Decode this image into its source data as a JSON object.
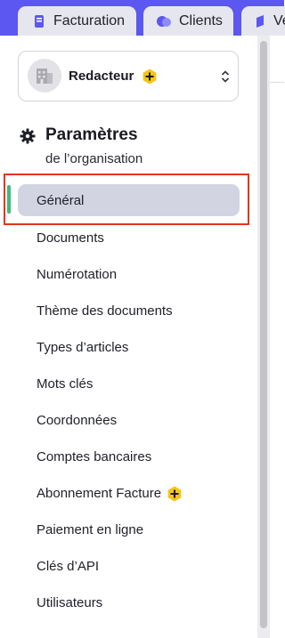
{
  "tabs": [
    {
      "label": "Facturation",
      "icon": "invoice-icon"
    },
    {
      "label": "Clients",
      "icon": "clients-icon"
    },
    {
      "label": "Ve",
      "icon": "sales-icon"
    }
  ],
  "org": {
    "name": "Redacteur",
    "premium": true
  },
  "section": {
    "title": "Paramètres",
    "subtitle": "de l’organisation"
  },
  "nav": [
    {
      "label": "Général",
      "active": true
    },
    {
      "label": "Documents"
    },
    {
      "label": "Numérotation"
    },
    {
      "label": "Thème des documents"
    },
    {
      "label": "Types d’articles"
    },
    {
      "label": "Mots clés"
    },
    {
      "label": "Coordonnées"
    },
    {
      "label": "Comptes bancaires"
    },
    {
      "label": "Abonnement Facture",
      "premium": true
    },
    {
      "label": "Paiement en ligne"
    },
    {
      "label": "Clés d’API"
    },
    {
      "label": "Utilisateurs"
    }
  ],
  "colors": {
    "accent": "#5b57f0",
    "active_marker": "#3cbc7d",
    "premium": "#f5c518",
    "highlight": "#e5331e"
  }
}
